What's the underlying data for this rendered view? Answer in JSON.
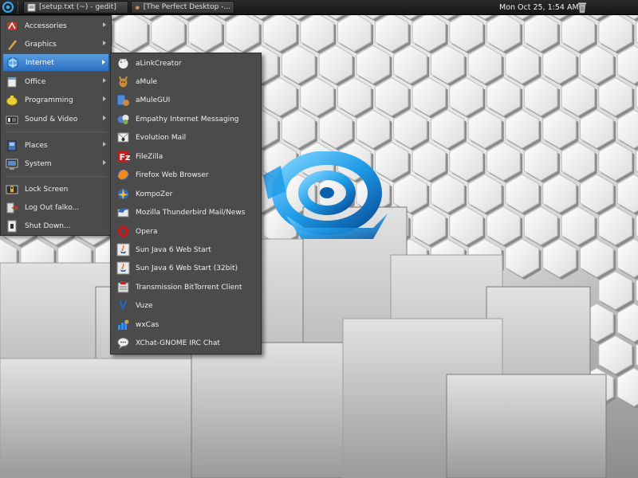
{
  "panel": {
    "clock": "Mon Oct 25,  1:54 AM",
    "tasks": [
      {
        "label": "[setup.txt (~) - gedit]",
        "icon": "gedit-icon"
      },
      {
        "label": "[The Perfect Desktop -...",
        "icon": "firefox-icon"
      }
    ]
  },
  "main_menu": {
    "items": [
      {
        "label": "Accessories",
        "icon": "accessories-icon",
        "submenu": true
      },
      {
        "label": "Graphics",
        "icon": "graphics-icon",
        "submenu": true
      },
      {
        "label": "Internet",
        "icon": "internet-icon",
        "submenu": true,
        "active": true
      },
      {
        "label": "Office",
        "icon": "office-icon",
        "submenu": true
      },
      {
        "label": "Programming",
        "icon": "programming-icon",
        "submenu": true
      },
      {
        "label": "Sound & Video",
        "icon": "sound-video-icon",
        "submenu": true
      },
      {
        "label": "Places",
        "icon": "places-icon",
        "submenu": true
      },
      {
        "label": "System",
        "icon": "system-icon",
        "submenu": true
      },
      {
        "label": "Lock Screen",
        "icon": "lock-icon",
        "submenu": false
      },
      {
        "label": "Log Out falko...",
        "icon": "logout-icon",
        "submenu": false
      },
      {
        "label": "Shut Down...",
        "icon": "shutdown-icon",
        "submenu": false
      }
    ]
  },
  "internet_menu": {
    "items": [
      {
        "label": "aLinkCreator",
        "icon": "alinkcreator-icon"
      },
      {
        "label": "aMule",
        "icon": "amule-icon"
      },
      {
        "label": "aMuleGUI",
        "icon": "amulegui-icon"
      },
      {
        "label": "Empathy Internet Messaging",
        "icon": "empathy-icon"
      },
      {
        "label": "Evolution Mail",
        "icon": "evolution-icon"
      },
      {
        "label": "FileZilla",
        "icon": "filezilla-icon"
      },
      {
        "label": "Firefox Web Browser",
        "icon": "firefox-icon"
      },
      {
        "label": "KompoZer",
        "icon": "kompozer-icon"
      },
      {
        "label": "Mozilla Thunderbird Mail/News",
        "icon": "thunderbird-icon"
      },
      {
        "label": "Opera",
        "icon": "opera-icon"
      },
      {
        "label": "Sun Java 6 Web Start",
        "icon": "java-icon"
      },
      {
        "label": "Sun Java 6 Web Start (32bit)",
        "icon": "java-icon"
      },
      {
        "label": "Transmission BitTorrent Client",
        "icon": "transmission-icon"
      },
      {
        "label": "Vuze",
        "icon": "vuze-icon"
      },
      {
        "label": "wxCas",
        "icon": "wxcas-icon"
      },
      {
        "label": "XChat-GNOME IRC Chat",
        "icon": "xchat-icon"
      }
    ]
  },
  "colors": {
    "menu_bg": "#4b4b4b",
    "highlight": "#3a7fd0",
    "panel_bg": "#1e1e1e",
    "logo_blue": "#1e9be8"
  }
}
